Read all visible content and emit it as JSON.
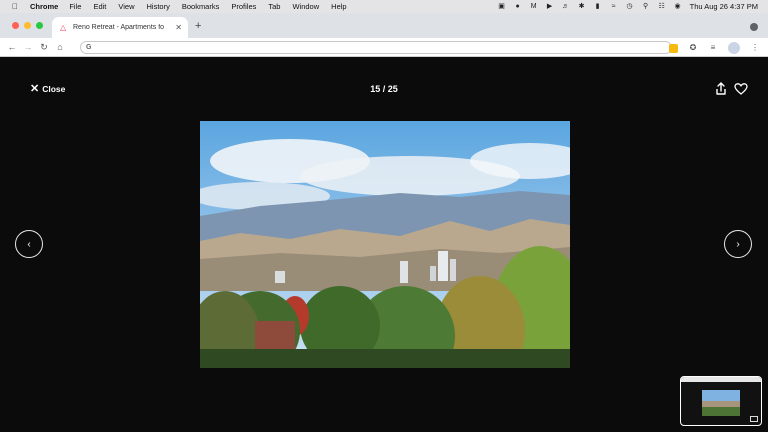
{
  "menubar": {
    "app": "Chrome",
    "items": [
      "File",
      "Edit",
      "View",
      "History",
      "Bookmarks",
      "Profiles",
      "Tab",
      "Window",
      "Help"
    ],
    "datetime": "Thu Aug 26  4:37 PM"
  },
  "browser": {
    "tab_title": "Reno Retreat - Apartments fo",
    "address_value": "",
    "address_placeholder": "",
    "colors": {
      "tab_strip": "#dee1e6",
      "favicon": "#ff385c"
    }
  },
  "viewer": {
    "close_label": "Close",
    "counter": "15 / 25",
    "icons": [
      "close-icon",
      "share-icon",
      "heart-icon",
      "chevron-left-icon",
      "chevron-right-icon"
    ]
  }
}
